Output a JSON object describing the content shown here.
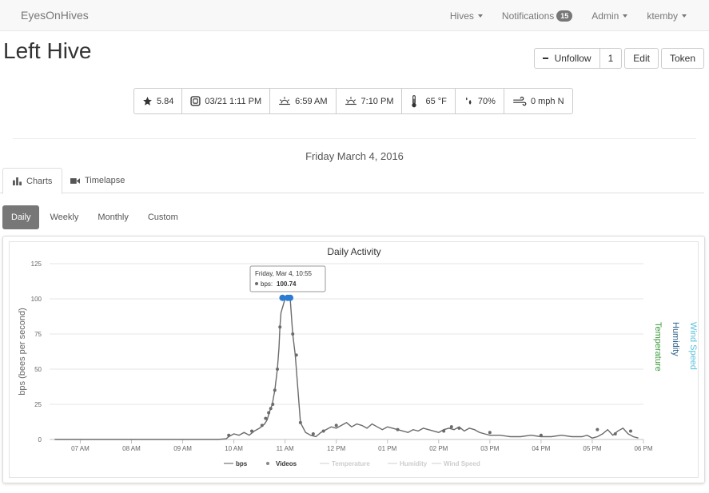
{
  "nav": {
    "brand": "EyesOnHives",
    "hives_label": "Hives",
    "notifications_label": "Notifications",
    "notifications_count": "15",
    "admin_label": "Admin",
    "user_label": "ktemby"
  },
  "page": {
    "title": "Left Hive",
    "unfollow_label": "Unfollow",
    "follow_count": "1",
    "edit_label": "Edit",
    "token_label": "Token"
  },
  "stats": {
    "rating": "5.84",
    "last_seen": "03/21 1:11 PM",
    "sunrise": "6:59 AM",
    "sunset": "7:10 PM",
    "temperature": "65 °F",
    "humidity": "70%",
    "wind": "0 mph N"
  },
  "date_heading": "Friday March 4, 2016",
  "tabs": {
    "charts": "Charts",
    "timelapse": "Timelapse"
  },
  "ranges": {
    "daily": "Daily",
    "weekly": "Weekly",
    "monthly": "Monthly",
    "custom": "Custom"
  },
  "icons": {
    "rating": "star-icon",
    "last_seen": "camera-icon",
    "sunrise": "sunrise-icon",
    "sunset": "sunset-icon",
    "temperature": "thermometer-icon",
    "humidity": "droplets-icon",
    "wind": "wind-icon",
    "charts_tab": "bar-chart-icon",
    "timelapse_tab": "video-icon"
  },
  "chart_data": {
    "type": "line",
    "title": "Daily Activity",
    "ylabel": "bps (bees per second)",
    "ylim": [
      0,
      125
    ],
    "yticks": [
      0,
      25,
      50,
      75,
      100,
      125
    ],
    "xticks": [
      "07 AM",
      "08 AM",
      "09 AM",
      "10 AM",
      "11 AM",
      "12 PM",
      "01 PM",
      "02 PM",
      "03 PM",
      "04 PM",
      "05 PM",
      "06 PM"
    ],
    "right_axis_labels": [
      "Temperature",
      "Humidity",
      "Wind Speed"
    ],
    "right_axis_colors": [
      "#3c9a3c",
      "#2a5f8a",
      "#5bc0de"
    ],
    "line_color": "#6b6b6b",
    "highlight_color": "#2a7bd4",
    "legend": [
      {
        "name": "bps",
        "active": true
      },
      {
        "name": "Videos",
        "active": true
      },
      {
        "name": "Temperature",
        "active": false
      },
      {
        "name": "Humidity",
        "active": false
      },
      {
        "name": "Wind Speed",
        "active": false
      }
    ],
    "tooltip": {
      "header": "Friday, Mar 4, 10:55",
      "series": "bps",
      "value": "100.74"
    },
    "series": [
      {
        "name": "bps",
        "x": [
          6.5,
          6.8,
          7.0,
          7.3,
          7.6,
          7.9,
          8.2,
          8.5,
          8.8,
          9.1,
          9.4,
          9.7,
          9.85,
          9.9,
          10.0,
          10.1,
          10.2,
          10.3,
          10.4,
          10.5,
          10.6,
          10.65,
          10.7,
          10.75,
          10.8,
          10.85,
          10.88,
          10.9,
          10.92,
          11.0,
          11.05,
          11.1,
          11.15,
          11.2,
          11.3,
          11.4,
          11.5,
          11.6,
          11.7,
          11.8,
          11.9,
          12.0,
          12.1,
          12.2,
          12.3,
          12.4,
          12.5,
          12.6,
          12.7,
          12.8,
          12.9,
          13.0,
          13.1,
          13.2,
          13.3,
          13.4,
          13.5,
          13.6,
          13.7,
          13.8,
          13.9,
          14.0,
          14.1,
          14.2,
          14.3,
          14.4,
          14.5,
          14.6,
          14.7,
          14.8,
          14.9,
          15.0,
          15.2,
          15.4,
          15.6,
          15.8,
          16.0,
          16.2,
          16.4,
          16.6,
          16.8,
          16.9,
          17.0,
          17.1,
          17.2,
          17.3,
          17.4,
          17.5,
          17.6,
          17.7,
          17.8,
          17.9
        ],
        "values": [
          0,
          0,
          0,
          0,
          0,
          0,
          0,
          0,
          0,
          0,
          0,
          0,
          0.5,
          2,
          4,
          3,
          5,
          3,
          6,
          8,
          11,
          14,
          20,
          25,
          35,
          50,
          65,
          80,
          90,
          100,
          101,
          100.74,
          75,
          60,
          12,
          5,
          3,
          2,
          5,
          7,
          9,
          8,
          10,
          12,
          9,
          11,
          10,
          8,
          11,
          9,
          7,
          9,
          8,
          7,
          6,
          5,
          7,
          6,
          8,
          7,
          6,
          5,
          7,
          8,
          7,
          9,
          6,
          8,
          7,
          5,
          4,
          3,
          3,
          2,
          2,
          3,
          2,
          2,
          3,
          2,
          2,
          3,
          1,
          2,
          4,
          7,
          3,
          6,
          8,
          4,
          2,
          1
        ]
      }
    ],
    "videos": {
      "x": [
        9.9,
        10.35,
        10.55,
        10.62,
        10.68,
        10.72,
        10.76,
        10.8,
        10.85,
        10.9,
        10.95,
        11.05,
        11.1,
        11.15,
        11.22,
        11.3,
        11.55,
        11.75,
        12.0,
        13.2,
        14.1,
        14.25,
        14.4,
        15.0,
        16.0,
        17.1,
        17.45,
        17.75
      ],
      "values": [
        3,
        6,
        10,
        15,
        19,
        22,
        25,
        35,
        50,
        80,
        100,
        100.74,
        100,
        75,
        60,
        12,
        4,
        6,
        10,
        7,
        6,
        9,
        8,
        5,
        3,
        7,
        4,
        6
      ]
    },
    "xlim": [
      6.4,
      18.0
    ]
  }
}
